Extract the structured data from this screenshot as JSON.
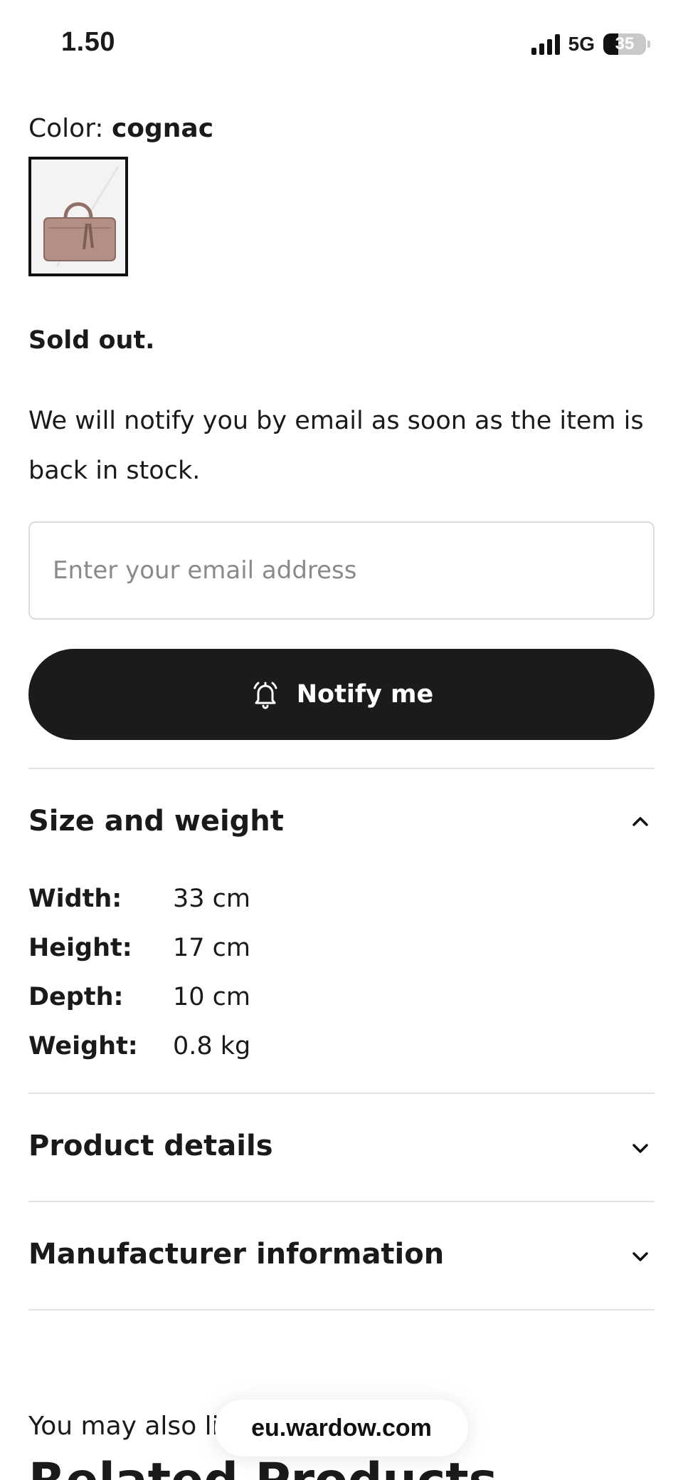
{
  "status_bar": {
    "time": "1.50",
    "network": "5G",
    "battery_percent": "35",
    "battery_level": 0.35
  },
  "product": {
    "color_label": "Color:",
    "color_value": "cognac",
    "swatch_icon": "handbag-thumbnail"
  },
  "stock": {
    "sold_out": "Sold out.",
    "notify_message": "We will notify you by email as soon as the item is back in stock.",
    "email_placeholder": "Enter your email address",
    "email_value": "",
    "notify_button_label": "Notify me",
    "notify_icon": "bell-icon"
  },
  "sections": {
    "size_weight": {
      "title": "Size and weight",
      "expanded": true,
      "specs": [
        {
          "label": "Width:",
          "value": "33 cm"
        },
        {
          "label": "Height:",
          "value": "17 cm"
        },
        {
          "label": "Depth:",
          "value": "10 cm"
        },
        {
          "label": "Weight:",
          "value": "0.8 kg"
        }
      ]
    },
    "product_details": {
      "title": "Product details",
      "expanded": false
    },
    "manufacturer": {
      "title": "Manufacturer information",
      "expanded": false
    }
  },
  "footer": {
    "also_like": "You may also lik",
    "related_title": "Related Products",
    "url": "eu.wardow.com"
  }
}
